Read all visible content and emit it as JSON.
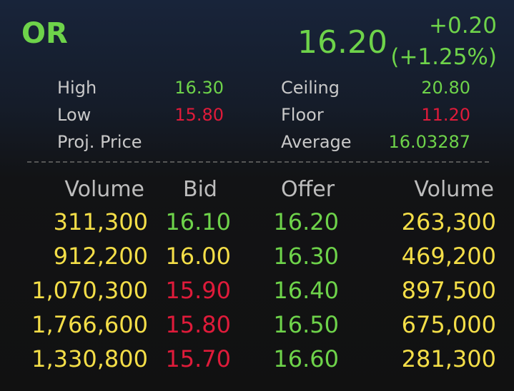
{
  "quote": {
    "symbol": "OR",
    "last_price": "16.20",
    "change": "+0.20",
    "change_percent": "(+1.25%)"
  },
  "stats": {
    "high_label": "High",
    "high_value": "16.30",
    "low_label": "Low",
    "low_value": "15.80",
    "proj_label": "Proj. Price",
    "proj_value": "",
    "ceiling_label": "Ceiling",
    "ceiling_value": "20.80",
    "floor_label": "Floor",
    "floor_value": "11.20",
    "average_label": "Average",
    "average_value": "16.03287"
  },
  "order_book": {
    "headers": {
      "bid_volume": "Volume",
      "bid": "Bid",
      "offer": "Offer",
      "offer_volume": "Volume"
    },
    "rows": [
      {
        "bid_volume": "311,300",
        "bid": "16.10",
        "offer": "16.20",
        "offer_volume": "263,300",
        "bid_color": "green",
        "offer_color": "green"
      },
      {
        "bid_volume": "912,200",
        "bid": "16.00",
        "offer": "16.30",
        "offer_volume": "469,200",
        "bid_color": "yellow",
        "offer_color": "green"
      },
      {
        "bid_volume": "1,070,300",
        "bid": "15.90",
        "offer": "16.40",
        "offer_volume": "897,500",
        "bid_color": "red",
        "offer_color": "green"
      },
      {
        "bid_volume": "1,766,600",
        "bid": "15.80",
        "offer": "16.50",
        "offer_volume": "675,000",
        "bid_color": "red",
        "offer_color": "green"
      },
      {
        "bid_volume": "1,330,800",
        "bid": "15.70",
        "offer": "16.60",
        "offer_volume": "281,300",
        "bid_color": "red",
        "offer_color": "green"
      }
    ]
  },
  "colors": {
    "up": "#6ed34a",
    "down": "#df1b3a",
    "unchanged": "#f4de48",
    "label": "#c9c9c9",
    "background": "#111111"
  }
}
